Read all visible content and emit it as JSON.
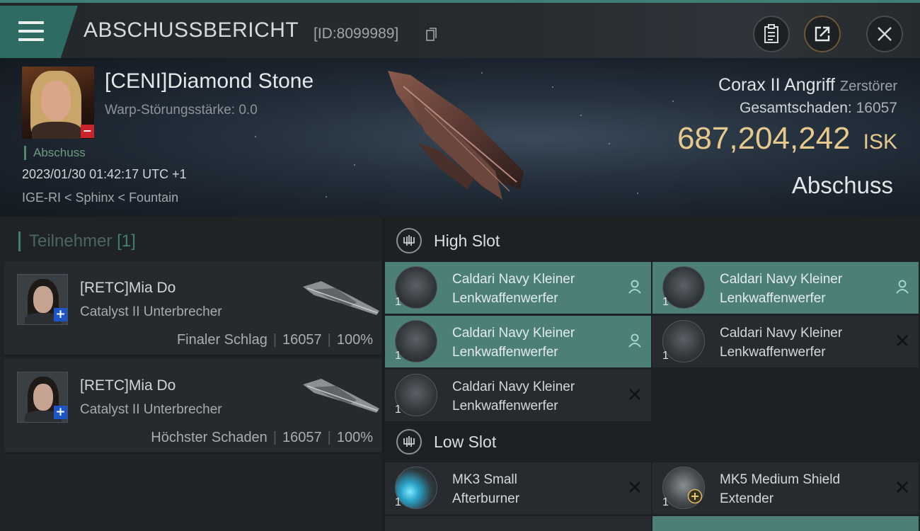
{
  "header": {
    "title": "ABSCHUSSBERICHT",
    "id": "[ID:8099989]",
    "icons": [
      "menu-icon",
      "copy-icon",
      "clipboard-icon",
      "share-icon",
      "close-icon"
    ]
  },
  "victim": {
    "name": "[CENI]Diamond Stone",
    "warp": "Warp-Störungsstärke: 0.0",
    "kill_label": "Abschuss",
    "time": "2023/01/30 01:42:17 UTC +1",
    "location": "IGE-RI < Sphinx < Fountain",
    "ship": "Corax II Angriff",
    "ship_class": "Zerstörer",
    "damage_label": "Gesamtschaden:",
    "damage": "16057",
    "isk_value": "687,204,242",
    "isk_unit": "ISK",
    "result": "Abschuss"
  },
  "participants": {
    "label": "Teilnehmer",
    "count": "[1]",
    "cards": [
      {
        "name": "[RETC]Mia Do",
        "ship": "Catalyst II Unterbrecher",
        "role": "Finaler Schlag",
        "damage": "16057",
        "percent": "100%"
      },
      {
        "name": "[RETC]Mia Do",
        "ship": "Catalyst II Unterbrecher",
        "role": "Höchster Schaden",
        "damage": "16057",
        "percent": "100%"
      }
    ]
  },
  "slots": {
    "high_title": "High Slot",
    "low_title": "Low Slot",
    "high": [
      {
        "line1": "Caldari Navy Kleiner",
        "line2": "Lenkwaffenwerfer",
        "qty": "1",
        "state": "person-icon",
        "highlighted": true
      },
      {
        "line1": "Caldari Navy Kleiner",
        "line2": "Lenkwaffenwerfer",
        "qty": "1",
        "state": "person-icon",
        "highlighted": true
      },
      {
        "line1": "Caldari Navy Kleiner",
        "line2": "Lenkwaffenwerfer",
        "qty": "1",
        "state": "person-icon",
        "highlighted": true
      },
      {
        "line1": "Caldari Navy Kleiner",
        "line2": "Lenkwaffenwerfer",
        "qty": "1",
        "state": "destroyed-icon",
        "highlighted": false
      },
      {
        "line1": "Caldari Navy Kleiner",
        "line2": "Lenkwaffenwerfer",
        "qty": "1",
        "state": "destroyed-icon",
        "highlighted": false
      }
    ],
    "low": [
      {
        "line1": "MK3 Small",
        "line2": "Afterburner",
        "qty": "1",
        "state": "destroyed-icon",
        "highlighted": false
      },
      {
        "line1": "MK5 Medium Shield",
        "line2": "Extender",
        "qty": "1",
        "state": "destroyed-icon",
        "highlighted": false
      }
    ]
  },
  "colors": {
    "accent": "#3f7f75",
    "isk": "#e6c98c",
    "highlight": "#4b7f78",
    "loss": "#c8242a",
    "pilot_badge": "#1d55c9"
  }
}
